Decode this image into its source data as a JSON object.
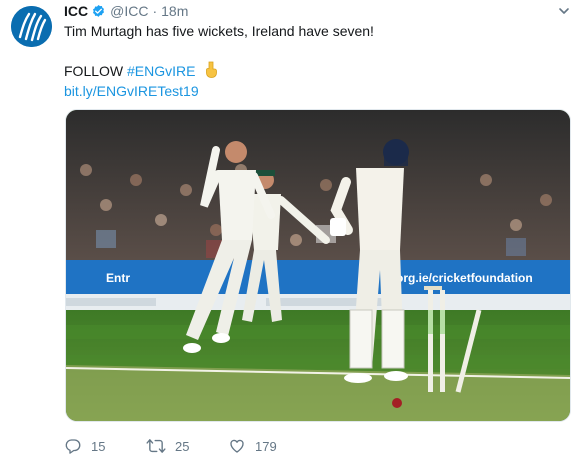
{
  "tweet": {
    "author_name": "ICC",
    "handle": "@ICC",
    "separator": "·",
    "time": "18m",
    "text_line1": "Tim Murtagh has five wickets, Ireland have seven!",
    "follow_prefix": "FOLLOW",
    "hashtag": "#ENGvIRE",
    "link": "bit.ly/ENGvIRETest19"
  },
  "media": {
    "boards": {
      "left_board": "Entr",
      "right_board": "org.ie/cricketfoundation"
    }
  },
  "actions": {
    "replies": "15",
    "retweets": "25",
    "likes": "179"
  },
  "colors": {
    "brand_blue": "#1da1f2",
    "link_blue": "#1b95e0",
    "muted": "#657786"
  },
  "icons": [
    "icc-logo",
    "verified-badge-icon",
    "chevron-down-icon",
    "pointing-down-emoji-icon",
    "reply-icon",
    "retweet-icon",
    "like-icon"
  ]
}
